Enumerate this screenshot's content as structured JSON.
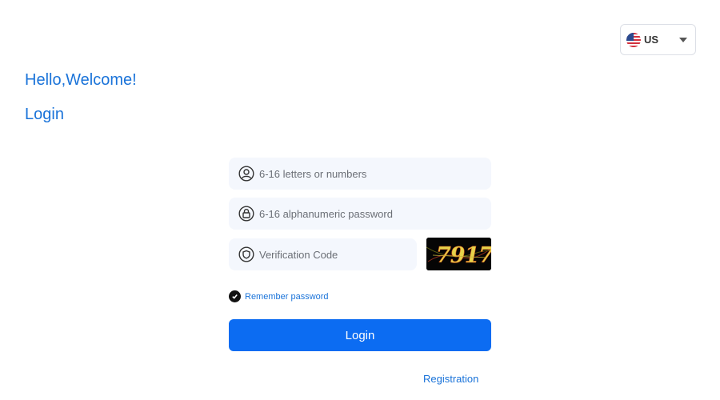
{
  "language": {
    "selected": "US",
    "flag_icon": "us-flag-icon",
    "dropdown_icon": "caret-down-icon"
  },
  "greeting": "Hello,Welcome!",
  "heading": "Login",
  "form": {
    "username": {
      "placeholder": "6-16 letters or numbers",
      "value": "",
      "icon": "user-icon"
    },
    "password": {
      "placeholder": "6-16 alphanumeric password",
      "value": "",
      "icon": "lock-icon"
    },
    "verification": {
      "placeholder": "Verification Code",
      "value": "",
      "icon": "shield-icon"
    },
    "captcha_text": "7917",
    "remember_label": "Remember password",
    "remember_checked": true,
    "login_label": "Login"
  },
  "registration_label": "Registration",
  "colors": {
    "accent_text": "#1a73d9",
    "primary_button": "#0c6cf2",
    "field_background": "#f4f7fd"
  }
}
